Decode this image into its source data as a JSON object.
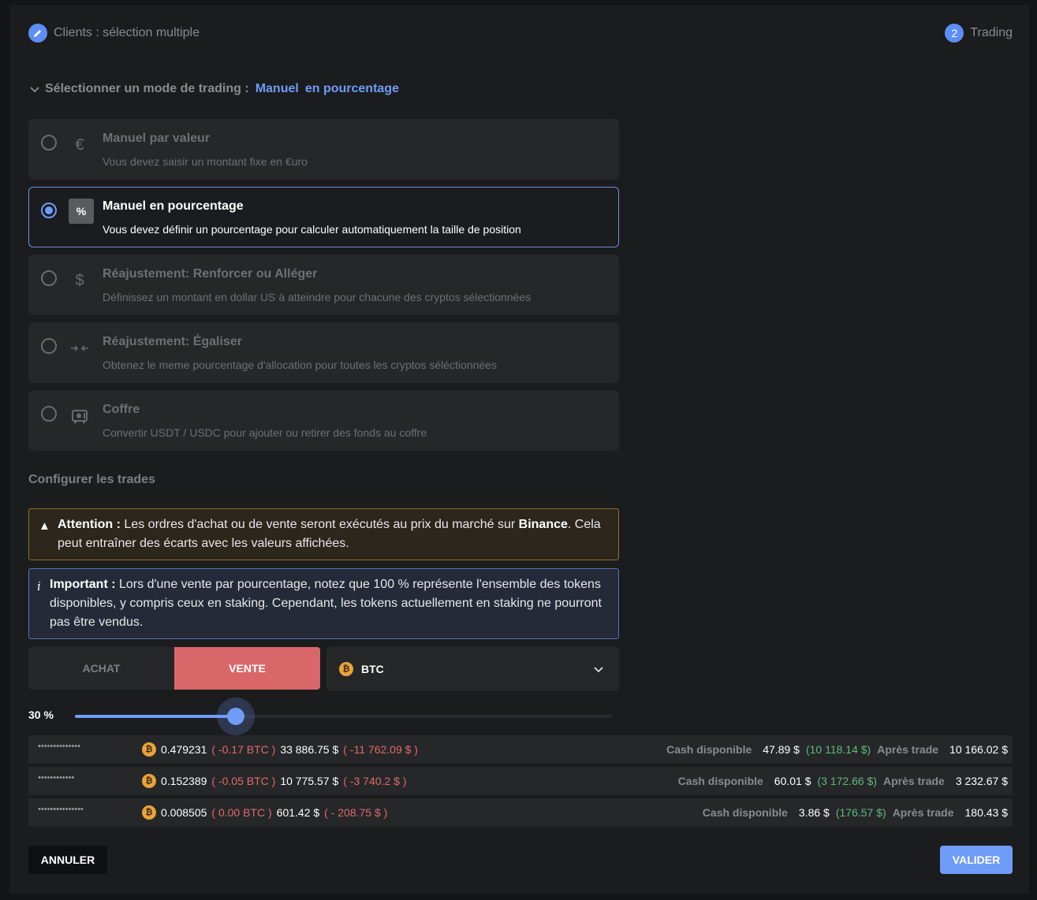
{
  "stepper": {
    "step1_label": "Clients : sélection multiple",
    "step2_number": "2",
    "step2_label": "Trading"
  },
  "mode": {
    "heading": "Sélectionner un mode de trading :",
    "selected_a": "Manuel",
    "selected_b": "en pourcentage"
  },
  "options": [
    {
      "icon": "€",
      "title": "Manuel par valeur",
      "desc": "Vous devez saisir un montant fixe en €uro",
      "selected": false
    },
    {
      "icon": "%",
      "title": "Manuel en pourcentage",
      "desc": "Vous devez définir un pourcentage pour calculer automatiquement la taille de position",
      "selected": true
    },
    {
      "icon": "$",
      "title": "Réajustement: Renforcer ou Alléger",
      "desc": "Définissez un montant en dollar US à atteindre pour chacune des cryptos sélectionnées",
      "selected": false
    },
    {
      "icon": "→←",
      "title": "Réajustement: Égaliser",
      "desc": "Obtenez le meme pourcentage d'allocation pour toutes les cryptos séléctionnées",
      "selected": false
    },
    {
      "icon": "safe",
      "title": "Coffre",
      "desc": "Convertir USDT / USDC pour ajouter ou retirer des fonds au coffre",
      "selected": false
    }
  ],
  "config_title": "Configurer les trades",
  "warning": {
    "label": "Attention :",
    "text_before": " Les ordres d'achat ou de vente seront exécutés au prix du marché sur ",
    "bold": "Binance",
    "text_after": ". Cela peut entraîner des écarts avec les valeurs affichées."
  },
  "info": {
    "label": "Important :",
    "text": " Lors d'une vente par pourcentage, notez que 100 % représente l'ensemble des tokens disponibles, y compris ceux en staking. Cependant, les tokens actuellement en staking ne pourront pas être vendus."
  },
  "side": {
    "buy": "ACHAT",
    "sell": "VENTE",
    "active": "sell"
  },
  "asset": {
    "symbol": "BTC",
    "icon": "₿"
  },
  "slider": {
    "label": "30 %",
    "value": 0.3
  },
  "rows": [
    {
      "name": "••••••••••••••",
      "qty": "0.479231",
      "qty_delta": "( -0.17 BTC )",
      "value": "33 886.75 $",
      "value_delta": "( -11 762.09 $ )",
      "cash_label": "Cash disponible",
      "cash": "47.89 $",
      "cash_delta": "(10 118.14 $)",
      "after_label": "Après trade",
      "after": "10 166.02 $"
    },
    {
      "name": "••••••••••••",
      "qty": "0.152389",
      "qty_delta": "( -0.05 BTC )",
      "value": "10 775.57 $",
      "value_delta": "( -3 740.2 $ )",
      "cash_label": "Cash disponible",
      "cash": "60.01 $",
      "cash_delta": "(3 172.66 $)",
      "after_label": "Après trade",
      "after": "3 232.67 $"
    },
    {
      "name": "•••••••••••••••",
      "qty": "0.008505",
      "qty_delta": "( 0.00 BTC )",
      "value": "601.42 $",
      "value_delta": "( - 208.75 $ )",
      "cash_label": "Cash disponible",
      "cash": "3.86 $",
      "cash_delta": "(176.57 $)",
      "after_label": "Après trade",
      "after": "180.43 $"
    }
  ],
  "buttons": {
    "cancel": "ANNULER",
    "validate": "VALIDER"
  }
}
